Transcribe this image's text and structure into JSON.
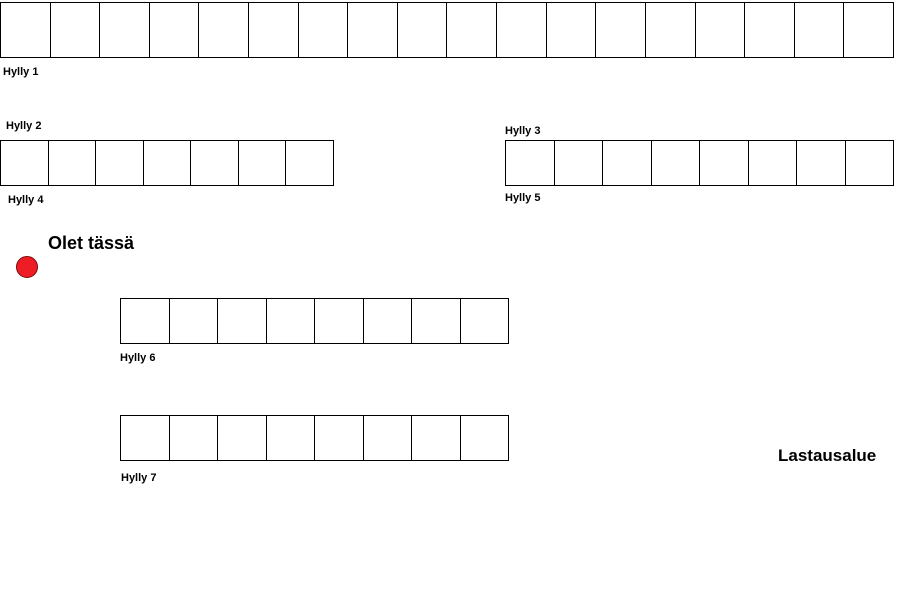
{
  "shelves": [
    {
      "id": "hylly-1",
      "label": "Hylly 1",
      "slots": 18
    },
    {
      "id": "hylly-2",
      "label": "Hylly 2",
      "slots": 7
    },
    {
      "id": "hylly-3",
      "label": "Hylly 3",
      "slots": 8
    },
    {
      "id": "hylly-4",
      "label": "Hylly 4"
    },
    {
      "id": "hylly-5",
      "label": "Hylly 5"
    },
    {
      "id": "hylly-6",
      "label": "Hylly 6",
      "slots": 8
    },
    {
      "id": "hylly-7",
      "label": "Hylly 7",
      "slots": 8
    }
  ],
  "current_location": {
    "label": "Olet tässä",
    "marker_color": "#ee1c24"
  },
  "loading_area": {
    "label": "Lastausalue"
  }
}
